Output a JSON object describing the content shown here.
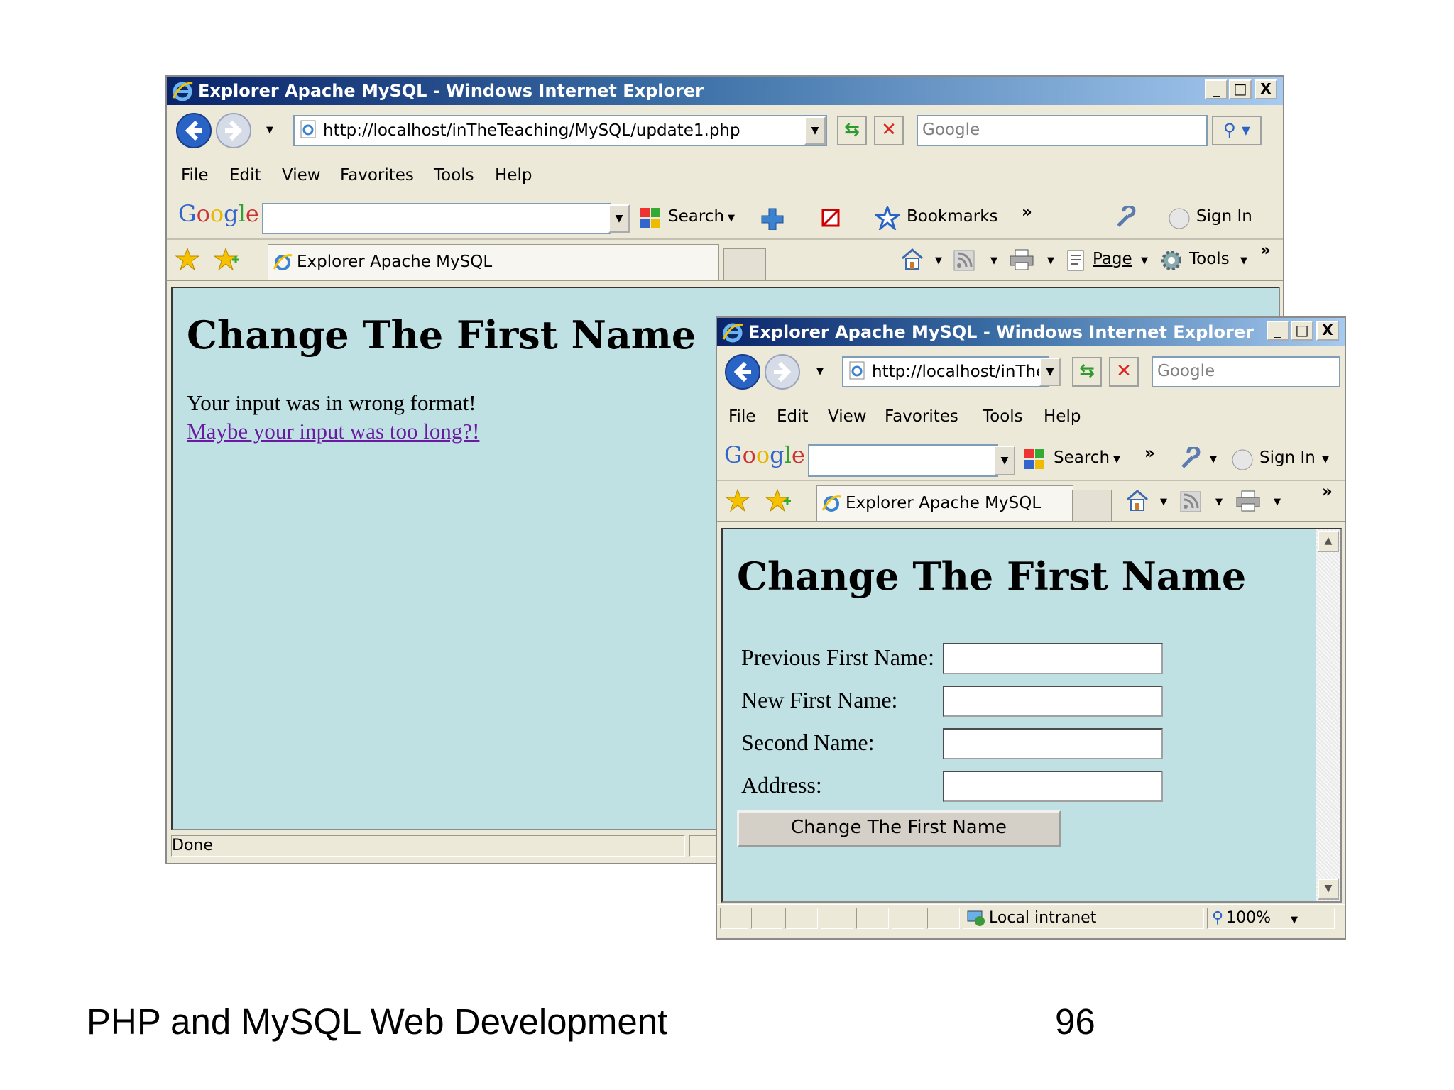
{
  "window": {
    "title": "Explorer Apache MySQL - Windows Internet Explorer",
    "buttons": {
      "minimize": "_",
      "maximize": "□",
      "close": "X"
    }
  },
  "menu": [
    "File",
    "Edit",
    "View",
    "Favorites",
    "Tools",
    "Help"
  ],
  "back_window": {
    "address": "http://localhost/inTheTeaching/MySQL/update1.php",
    "search_placeholder": "Google",
    "google_toolbar": {
      "logo": "Google",
      "search": "Search",
      "bookmarks": "Bookmarks",
      "signin": "Sign In"
    },
    "tab": "Explorer Apache MySQL",
    "commands": {
      "page": "Page",
      "tools": "Tools"
    },
    "content": {
      "heading": "Change The First Name",
      "message": "Your input was in wrong format!",
      "link": "Maybe your input was too long?!"
    },
    "status": "Done"
  },
  "front_window": {
    "address": "http://localhost/inThe",
    "search_placeholder": "Google",
    "google_toolbar": {
      "logo": "Google",
      "search": "Search",
      "signin": "Sign In"
    },
    "tab": "Explorer Apache MySQL",
    "content": {
      "heading": "Change The First Name",
      "fields": [
        {
          "label": "Previous First Name:",
          "value": ""
        },
        {
          "label": "New First Name:",
          "value": ""
        },
        {
          "label": "Second Name:",
          "value": ""
        },
        {
          "label": "Address:",
          "value": ""
        }
      ],
      "submit": "Change The First Name"
    },
    "status": {
      "zone": "Local intranet",
      "zoom": "100%"
    }
  },
  "footer": {
    "title": "PHP and MySQL Web Development",
    "page_number": "96"
  },
  "colors": {
    "page_background": "#bfe1e4",
    "titlebar_dark": "#0a246a",
    "titlebar_light": "#a6caf0",
    "link": "#6a1aa0",
    "chrome": "#ece9d8"
  },
  "icons": [
    "ie-logo-icon",
    "back-icon",
    "forward-icon",
    "refresh-icon",
    "stop-icon",
    "search-icon",
    "favorites-star-icon",
    "add-favorite-icon",
    "home-icon",
    "feeds-icon",
    "print-icon",
    "page-icon",
    "tools-gear-icon",
    "wrench-icon",
    "local-intranet-icon",
    "zoom-icon"
  ]
}
